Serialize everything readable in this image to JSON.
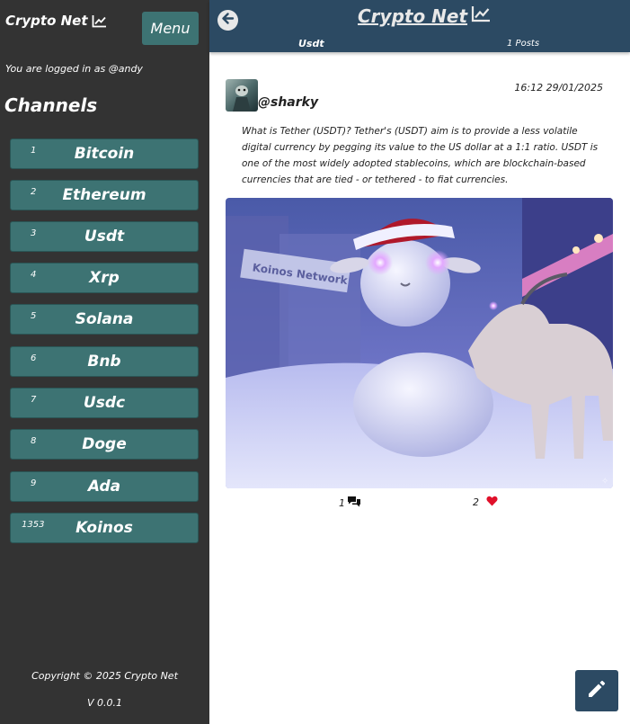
{
  "sidebar": {
    "brand": "Crypto Net",
    "menu_label": "Menu",
    "logged_in_text": "You are logged in as @andy",
    "channels_title": "Channels",
    "channels": [
      {
        "num": "1",
        "name": "Bitcoin"
      },
      {
        "num": "2",
        "name": "Ethereum"
      },
      {
        "num": "3",
        "name": "Usdt"
      },
      {
        "num": "4",
        "name": "Xrp"
      },
      {
        "num": "5",
        "name": "Solana"
      },
      {
        "num": "6",
        "name": "Bnb"
      },
      {
        "num": "7",
        "name": "Usdc"
      },
      {
        "num": "8",
        "name": "Doge"
      },
      {
        "num": "9",
        "name": "Ada"
      },
      {
        "num": "1353",
        "name": "Koinos"
      }
    ],
    "copyright": "Copyright © 2025 Crypto Net",
    "version": "V 0.0.1"
  },
  "header": {
    "title": "Crypto Net",
    "channel": "Usdt",
    "posts_count": "1 Posts"
  },
  "post": {
    "username": "@sharky",
    "timestamp": "16:12 29/01/2025",
    "text": "What is Tether (USDT)? Tether's (USDT) aim is to provide a less volatile digital currency by pegging its value to the US dollar at a 1:1 ratio. USDT is one of the most widely adopted stablecoins, which are blockchain-based currencies that are tied - or tethered - to fiat currencies.",
    "image_sign_text": "Koinos Network",
    "comments": "1",
    "likes": "2"
  },
  "colors": {
    "sidebar_bg": "#333333",
    "channel_button": "#3d7373",
    "header_bg": "#2c4a63",
    "like_heart": "#e0102a"
  },
  "icons": {
    "brand": "chart-line-icon",
    "back": "arrow-left-circle-icon",
    "comments": "comments-icon",
    "likes": "heart-icon",
    "compose": "pencil-icon"
  }
}
